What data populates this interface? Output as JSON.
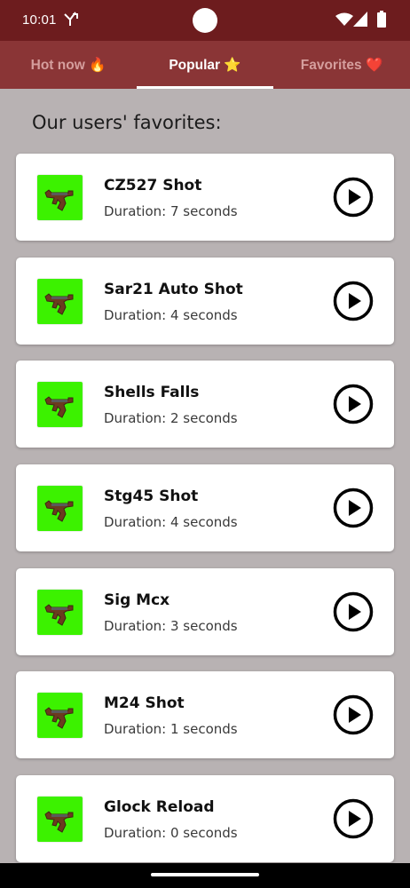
{
  "status_bar": {
    "time": "10:01"
  },
  "tabs": [
    {
      "label": "Hot now 🔥",
      "active": false
    },
    {
      "label": "Popular ⭐",
      "active": true
    },
    {
      "label": "Favorites ❤️",
      "active": false
    }
  ],
  "heading": "Our users' favorites:",
  "sounds": [
    {
      "title": "CZ527 Shot",
      "duration": "Duration: 7 seconds"
    },
    {
      "title": "Sar21 Auto Shot",
      "duration": "Duration: 4 seconds"
    },
    {
      "title": "Shells Falls",
      "duration": "Duration: 2 seconds"
    },
    {
      "title": "Stg45 Shot",
      "duration": "Duration: 4 seconds"
    },
    {
      "title": "Sig Mcx",
      "duration": "Duration: 3 seconds"
    },
    {
      "title": "M24 Shot",
      "duration": "Duration: 1 seconds"
    },
    {
      "title": "Glock Reload",
      "duration": "Duration: 0 seconds"
    }
  ],
  "colors": {
    "status_bar": "#6d1c1e",
    "tab_bar": "#8a3536",
    "tab_inactive": "#d59e9d",
    "background": "#b8b2b3",
    "thumbnail": "#3cf200"
  },
  "icons": {
    "thumbnail": "rifle-icon",
    "action": "play-circle-icon"
  }
}
